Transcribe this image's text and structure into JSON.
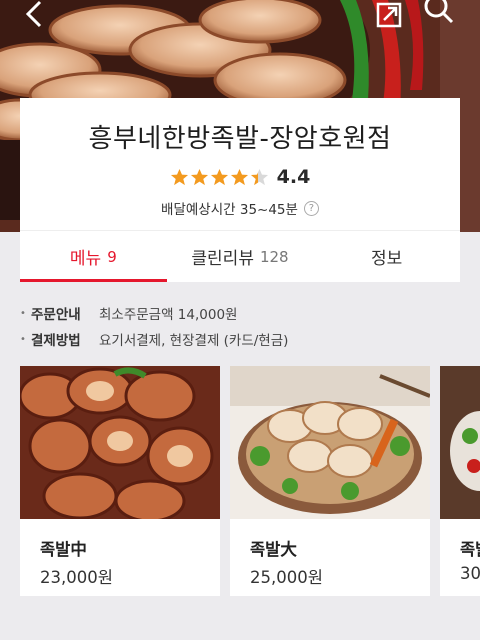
{
  "header": {
    "icons": [
      "back-icon",
      "share-icon",
      "search-icon"
    ]
  },
  "store": {
    "name": "흥부네한방족발-장암호원점",
    "rating": 4.4,
    "rating_text": "4.4",
    "delivery_time": "배달예상시간 35~45분",
    "help_glyph": "?"
  },
  "tabs": [
    {
      "label": "메뉴",
      "count": "9",
      "active": true
    },
    {
      "label": "클린리뷰",
      "count": "128",
      "active": false
    },
    {
      "label": "정보",
      "count": "",
      "active": false
    }
  ],
  "notice": [
    {
      "label": "주문안내",
      "value": "최소주문금액 14,000원"
    },
    {
      "label": "결제방법",
      "value": "요기서결제, 현장결제 (카드/현금)"
    }
  ],
  "products": [
    {
      "name": "족발中",
      "price": "23,000원"
    },
    {
      "name": "족발大",
      "price": "25,000원"
    },
    {
      "name": "족발",
      "price": "30"
    }
  ],
  "colors": {
    "accent": "#e5172d",
    "star": "#f39a1f",
    "background": "#ecebee"
  }
}
